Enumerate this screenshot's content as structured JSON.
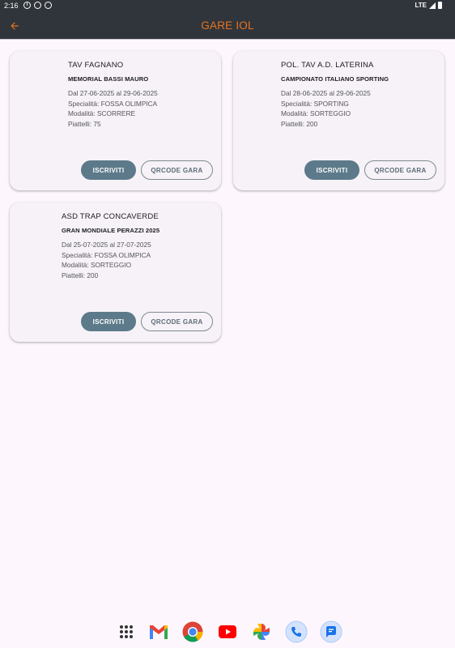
{
  "status_bar": {
    "time": "2:16",
    "network": "LTE"
  },
  "app_bar": {
    "title": "GARE IOL"
  },
  "colors": {
    "app_bar_bg": "#30353b",
    "title_accent": "#e8731f",
    "primary_button": "#5c7a8a",
    "card_bg": "#f6f2f8",
    "page_bg": "#fdf7fd"
  },
  "cards": [
    {
      "club": "TAV FAGNANO",
      "event": "MEMORIAL BASSI MAURO",
      "dates": "Dal 27-06-2025 al 29-06-2025",
      "specialty": "Specialità: FOSSA OLIMPICA",
      "mode": "Modalità: SCORRERE",
      "targets": "Piattelli: 75",
      "register_label": "ISCRIVITI",
      "qrcode_label": "QRCODE GARA"
    },
    {
      "club": "POL. TAV A.D. LATERINA",
      "event": "CAMPIONATO ITALIANO SPORTING",
      "dates": "Dal 28-06-2025 al 29-06-2025",
      "specialty": "Specialità: SPORTING",
      "mode": "Modalità: SORTEGGIO",
      "targets": "Piattelli: 200",
      "register_label": "ISCRIVITI",
      "qrcode_label": "QRCODE GARA"
    },
    {
      "club": "ASD TRAP CONCAVERDE",
      "event": "GRAN MONDIALE PERAZZI 2025",
      "dates": "Dal 25-07-2025 al 27-07-2025",
      "specialty": "Specialità: FOSSA OLIMPICA",
      "mode": "Modalità: SORTEGGIO",
      "targets": "Piattelli: 200",
      "register_label": "ISCRIVITI",
      "qrcode_label": "QRCODE GARA"
    }
  ],
  "dock": {
    "apps": [
      "app-drawer-icon",
      "gmail-icon",
      "chrome-icon",
      "youtube-icon",
      "photos-icon",
      "phone-icon",
      "messages-icon"
    ]
  }
}
